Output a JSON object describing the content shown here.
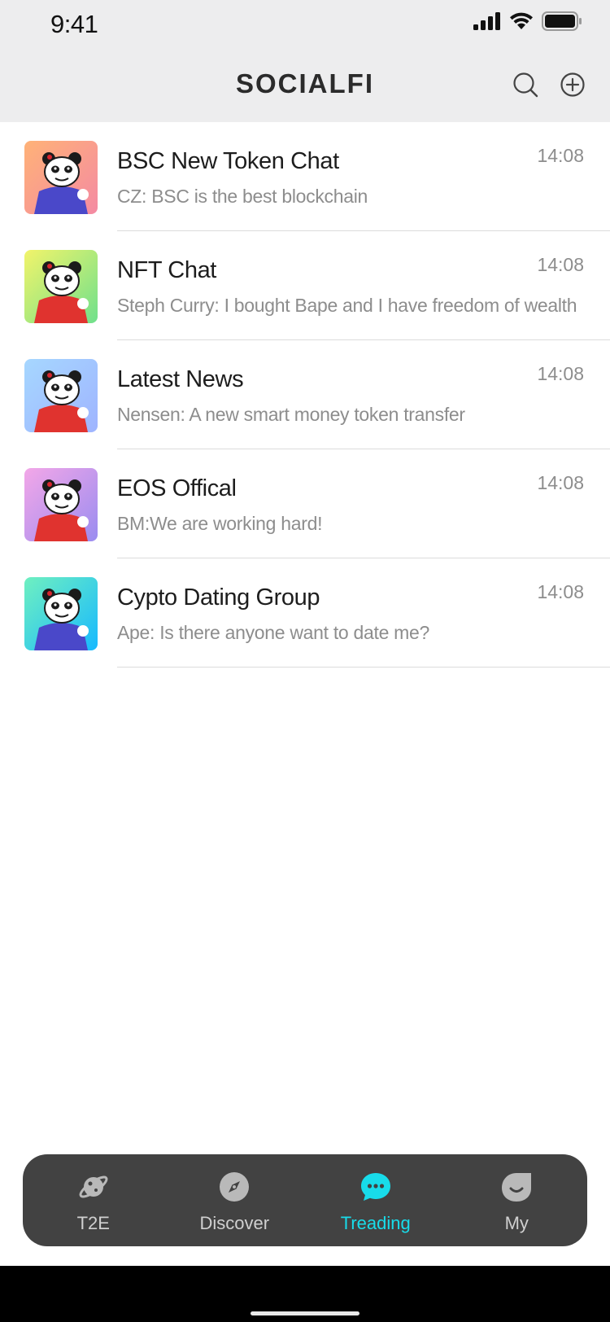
{
  "status": {
    "time": "9:41"
  },
  "header": {
    "title": "SOCIALFI"
  },
  "chats": [
    {
      "title": "BSC New Token Chat",
      "preview": "CZ: BSC is the best blockchain",
      "time": "14:08",
      "bg_from": "#ffb277",
      "bg_to": "#f48aa3",
      "shirt": "#4a48c9"
    },
    {
      "title": "NFT Chat",
      "preview": "Steph Curry: I bought Bape and I have freedom of wealth",
      "time": "14:08",
      "bg_from": "#f2f46a",
      "bg_to": "#6fe08c",
      "shirt": "#e0332f"
    },
    {
      "title": "Latest News",
      "preview": "Nensen: A new smart money token transfer",
      "time": "14:08",
      "bg_from": "#a6d7ff",
      "bg_to": "#9fb4ff",
      "shirt": "#e0332f"
    },
    {
      "title": "EOS Offical",
      "preview": "BM:We are working hard!",
      "time": "14:08",
      "bg_from": "#f3a7e8",
      "bg_to": "#9a8cf0",
      "shirt": "#e0332f"
    },
    {
      "title": "Cypto Dating Group",
      "preview": "Ape: Is there anyone want to date me?",
      "time": "14:08",
      "bg_from": "#6ff0c0",
      "bg_to": "#17b9ff",
      "shirt": "#4a48c9"
    }
  ],
  "tabs": [
    {
      "label": "T2E",
      "icon": "planet-icon",
      "active": false
    },
    {
      "label": "Discover",
      "icon": "compass-icon",
      "active": false
    },
    {
      "label": "Treading",
      "icon": "chat-bubble-icon",
      "active": true
    },
    {
      "label": "My",
      "icon": "profile-icon",
      "active": false
    }
  ],
  "colors": {
    "accent": "#18dcea",
    "tabbar": "#424242",
    "header_bg": "#ededee"
  }
}
